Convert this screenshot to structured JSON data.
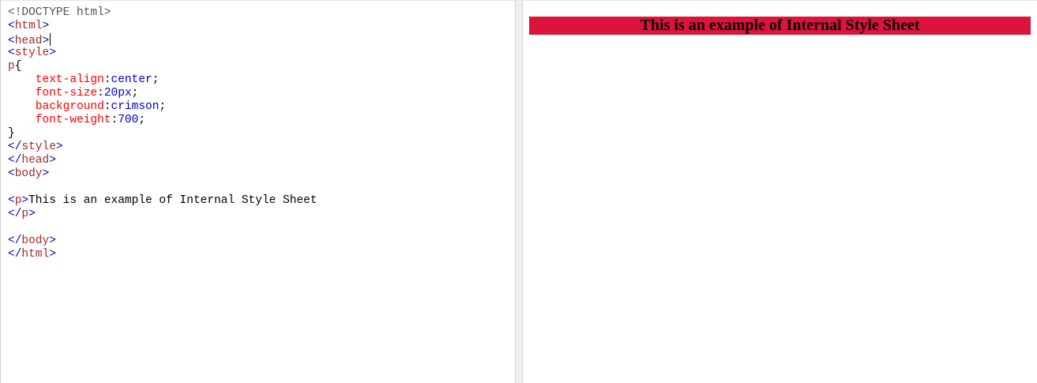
{
  "editor": {
    "lines": [
      {
        "tokens": [
          {
            "t": "<!DOCTYPE html>",
            "k": "doctype"
          }
        ]
      },
      {
        "tokens": [
          {
            "t": "<",
            "k": "bracket"
          },
          {
            "t": "html",
            "k": "tag"
          },
          {
            "t": ">",
            "k": "bracket"
          }
        ]
      },
      {
        "tokens": [
          {
            "t": "<",
            "k": "bracket"
          },
          {
            "t": "head",
            "k": "tag"
          },
          {
            "t": ">",
            "k": "bracket"
          }
        ],
        "caret": true
      },
      {
        "tokens": [
          {
            "t": "<",
            "k": "bracket"
          },
          {
            "t": "style",
            "k": "tag"
          },
          {
            "t": ">",
            "k": "bracket"
          }
        ]
      },
      {
        "tokens": [
          {
            "t": "p",
            "k": "selector"
          },
          {
            "t": "{",
            "k": "punct"
          }
        ]
      },
      {
        "tokens": [
          {
            "t": "    ",
            "k": "text"
          },
          {
            "t": "text-align",
            "k": "prop"
          },
          {
            "t": ":",
            "k": "punct"
          },
          {
            "t": "center",
            "k": "value"
          },
          {
            "t": ";",
            "k": "punct"
          }
        ]
      },
      {
        "tokens": [
          {
            "t": "    ",
            "k": "text"
          },
          {
            "t": "font-size",
            "k": "prop"
          },
          {
            "t": ":",
            "k": "punct"
          },
          {
            "t": "20px",
            "k": "value"
          },
          {
            "t": ";",
            "k": "punct"
          }
        ]
      },
      {
        "tokens": [
          {
            "t": "    ",
            "k": "text"
          },
          {
            "t": "background",
            "k": "prop"
          },
          {
            "t": ":",
            "k": "punct"
          },
          {
            "t": "crimson",
            "k": "value"
          },
          {
            "t": ";",
            "k": "punct"
          }
        ]
      },
      {
        "tokens": [
          {
            "t": "    ",
            "k": "text"
          },
          {
            "t": "font-weight",
            "k": "prop"
          },
          {
            "t": ":",
            "k": "punct"
          },
          {
            "t": "700",
            "k": "value"
          },
          {
            "t": ";",
            "k": "punct"
          }
        ]
      },
      {
        "tokens": [
          {
            "t": "}",
            "k": "punct"
          }
        ]
      },
      {
        "tokens": [
          {
            "t": "</",
            "k": "bracket"
          },
          {
            "t": "style",
            "k": "tag"
          },
          {
            "t": ">",
            "k": "bracket"
          }
        ]
      },
      {
        "tokens": [
          {
            "t": "</",
            "k": "bracket"
          },
          {
            "t": "head",
            "k": "tag"
          },
          {
            "t": ">",
            "k": "bracket"
          }
        ]
      },
      {
        "tokens": [
          {
            "t": "<",
            "k": "bracket"
          },
          {
            "t": "body",
            "k": "tag"
          },
          {
            "t": ">",
            "k": "bracket"
          }
        ]
      },
      {
        "tokens": []
      },
      {
        "tokens": [
          {
            "t": "<",
            "k": "bracket"
          },
          {
            "t": "p",
            "k": "tag"
          },
          {
            "t": ">",
            "k": "bracket"
          },
          {
            "t": "This is an example of Internal Style Sheet",
            "k": "text"
          }
        ]
      },
      {
        "tokens": [
          {
            "t": "</",
            "k": "bracket"
          },
          {
            "t": "p",
            "k": "tag"
          },
          {
            "t": ">",
            "k": "bracket"
          }
        ]
      },
      {
        "tokens": []
      },
      {
        "tokens": [
          {
            "t": "</",
            "k": "bracket"
          },
          {
            "t": "body",
            "k": "tag"
          },
          {
            "t": ">",
            "k": "bracket"
          }
        ]
      },
      {
        "tokens": [
          {
            "t": "</",
            "k": "bracket"
          },
          {
            "t": "html",
            "k": "tag"
          },
          {
            "t": ">",
            "k": "bracket"
          }
        ]
      }
    ]
  },
  "preview": {
    "paragraph_text": "This is an example of Internal Style Sheet",
    "paragraph_background": "#dc143c"
  },
  "colors": {
    "tag": "#a52a2a",
    "bracket": "#0000cd",
    "property": "#ff0000",
    "value": "#0000cd",
    "doctype": "#555555"
  }
}
